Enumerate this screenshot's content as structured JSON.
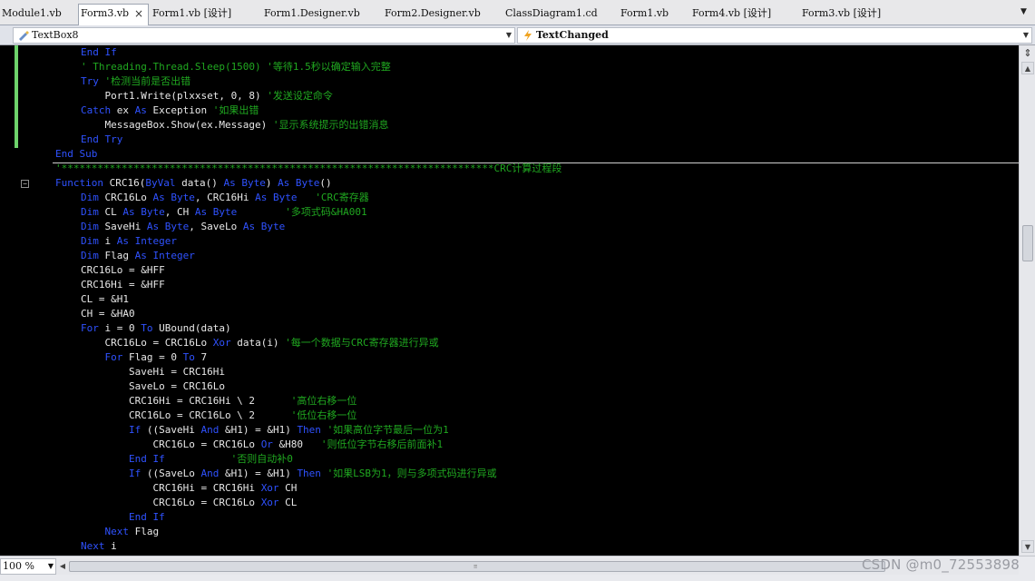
{
  "tabs": [
    {
      "label": "Module1.vb",
      "active": false
    },
    {
      "label": "Form3.vb",
      "active": true
    },
    {
      "label": "Form1.vb [设计]",
      "active": false
    },
    {
      "label": "Form1.Designer.vb",
      "active": false
    },
    {
      "label": "Form2.Designer.vb",
      "active": false
    },
    {
      "label": "ClassDiagram1.cd",
      "active": false
    },
    {
      "label": "Form1.vb",
      "active": false
    },
    {
      "label": "Form4.vb [设计]",
      "active": false
    },
    {
      "label": "Form3.vb [设计]",
      "active": false
    }
  ],
  "active_tab_close": "×",
  "nav": {
    "object_combo": "TextBox8",
    "event_combo": "TextChanged"
  },
  "code_lines": [
    [
      [
        "kw",
        "End If"
      ]
    ],
    [
      [
        "cm",
        "' Threading.Thread.Sleep(1500) '等待1.5秒以确定输入完整"
      ]
    ],
    [
      [
        "kw",
        "Try"
      ],
      [
        "pl",
        " "
      ],
      [
        "cm",
        "'检测当前是否出错"
      ]
    ],
    [
      [
        "pl",
        "    Port1.Write(plxxset, 0, 8) "
      ],
      [
        "cm",
        "'发送设定命令"
      ]
    ],
    [
      [
        "kw",
        "Catch"
      ],
      [
        "pl",
        " ex "
      ],
      [
        "kw",
        "As"
      ],
      [
        "pl",
        " Exception "
      ],
      [
        "cm",
        "'如果出错"
      ]
    ],
    [
      [
        "pl",
        "    MessageBox.Show(ex.Message) "
      ],
      [
        "cm",
        "'显示系统提示的出错消息"
      ]
    ],
    [
      [
        "kw",
        "End Try"
      ]
    ],
    [
      [
        "kw",
        "End Sub"
      ]
    ],
    [
      [
        "cm",
        "'************************************************************************CRC计算过程段"
      ]
    ],
    [
      [
        "kw",
        "Function"
      ],
      [
        "pl",
        " CRC16("
      ],
      [
        "kw",
        "ByVal"
      ],
      [
        "pl",
        " data() "
      ],
      [
        "kw",
        "As Byte"
      ],
      [
        "pl",
        ") "
      ],
      [
        "kw",
        "As Byte"
      ],
      [
        "pl",
        "()"
      ]
    ],
    [
      [
        "kw",
        "Dim"
      ],
      [
        "pl",
        " CRC16Lo "
      ],
      [
        "kw",
        "As Byte"
      ],
      [
        "pl",
        ", CRC16Hi "
      ],
      [
        "kw",
        "As Byte"
      ],
      [
        "pl",
        "   "
      ],
      [
        "cm",
        "'CRC寄存器"
      ]
    ],
    [
      [
        "kw",
        "Dim"
      ],
      [
        "pl",
        " CL "
      ],
      [
        "kw",
        "As Byte"
      ],
      [
        "pl",
        ", CH "
      ],
      [
        "kw",
        "As Byte"
      ],
      [
        "pl",
        "        "
      ],
      [
        "cm",
        "'多项式码&HA001"
      ]
    ],
    [
      [
        "kw",
        "Dim"
      ],
      [
        "pl",
        " SaveHi "
      ],
      [
        "kw",
        "As Byte"
      ],
      [
        "pl",
        ", SaveLo "
      ],
      [
        "kw",
        "As Byte"
      ]
    ],
    [
      [
        "kw",
        "Dim"
      ],
      [
        "pl",
        " i "
      ],
      [
        "kw",
        "As Integer"
      ]
    ],
    [
      [
        "kw",
        "Dim"
      ],
      [
        "pl",
        " Flag "
      ],
      [
        "kw",
        "As Integer"
      ]
    ],
    [
      [
        "pl",
        "CRC16Lo = &HFF"
      ]
    ],
    [
      [
        "pl",
        "CRC16Hi = &HFF"
      ]
    ],
    [
      [
        "pl",
        "CL = &H1"
      ]
    ],
    [
      [
        "pl",
        "CH = &HA0"
      ]
    ],
    [
      [
        "kw",
        "For"
      ],
      [
        "pl",
        " i = 0 "
      ],
      [
        "kw",
        "To"
      ],
      [
        "pl",
        " UBound(data)"
      ]
    ],
    [
      [
        "pl",
        "    CRC16Lo = CRC16Lo "
      ],
      [
        "kw",
        "Xor"
      ],
      [
        "pl",
        " data(i) "
      ],
      [
        "cm",
        "'每一个数据与CRC寄存器进行异或"
      ]
    ],
    [
      [
        "pl",
        "    "
      ],
      [
        "kw",
        "For"
      ],
      [
        "pl",
        " Flag = 0 "
      ],
      [
        "kw",
        "To"
      ],
      [
        "pl",
        " 7"
      ]
    ],
    [
      [
        "pl",
        "        SaveHi = CRC16Hi"
      ]
    ],
    [
      [
        "pl",
        "        SaveLo = CRC16Lo"
      ]
    ],
    [
      [
        "pl",
        "        CRC16Hi = CRC16Hi \\ 2      "
      ],
      [
        "cm",
        "'高位右移一位"
      ]
    ],
    [
      [
        "pl",
        "        CRC16Lo = CRC16Lo \\ 2      "
      ],
      [
        "cm",
        "'低位右移一位"
      ]
    ],
    [
      [
        "pl",
        "        "
      ],
      [
        "kw",
        "If"
      ],
      [
        "pl",
        " ((SaveHi "
      ],
      [
        "kw",
        "And"
      ],
      [
        "pl",
        " &H1) = &H1) "
      ],
      [
        "kw",
        "Then"
      ],
      [
        "pl",
        " "
      ],
      [
        "cm",
        "'如果高位字节最后一位为1"
      ]
    ],
    [
      [
        "pl",
        "            CRC16Lo = CRC16Lo "
      ],
      [
        "kw",
        "Or"
      ],
      [
        "pl",
        " &H80   "
      ],
      [
        "cm",
        "'则低位字节右移后前面补1"
      ]
    ],
    [
      [
        "pl",
        "        "
      ],
      [
        "kw",
        "End If"
      ],
      [
        "pl",
        "           "
      ],
      [
        "cm",
        "'否则自动补0"
      ]
    ],
    [
      [
        "pl",
        "        "
      ],
      [
        "kw",
        "If"
      ],
      [
        "pl",
        " ((SaveLo "
      ],
      [
        "kw",
        "And"
      ],
      [
        "pl",
        " &H1) = &H1) "
      ],
      [
        "kw",
        "Then"
      ],
      [
        "pl",
        " "
      ],
      [
        "cm",
        "'如果LSB为1，则与多项式码进行异或"
      ]
    ],
    [
      [
        "pl",
        "            CRC16Hi = CRC16Hi "
      ],
      [
        "kw",
        "Xor"
      ],
      [
        "pl",
        " CH"
      ]
    ],
    [
      [
        "pl",
        "            CRC16Lo = CRC16Lo "
      ],
      [
        "kw",
        "Xor"
      ],
      [
        "pl",
        " CL"
      ]
    ],
    [
      [
        "pl",
        "        "
      ],
      [
        "kw",
        "End If"
      ]
    ],
    [
      [
        "pl",
        "    "
      ],
      [
        "kw",
        "Next"
      ],
      [
        "pl",
        " Flag"
      ]
    ],
    [
      [
        "kw",
        "Next"
      ],
      [
        "pl",
        " i"
      ]
    ]
  ],
  "zoom_value": "100 %",
  "watermark": "CSDN @m0_72553898",
  "colors": {
    "keyword": "#2f52ff",
    "comment": "#20a820",
    "plain": "#e8e8e8",
    "background": "#000000",
    "change_bar": "#6ed36b"
  }
}
